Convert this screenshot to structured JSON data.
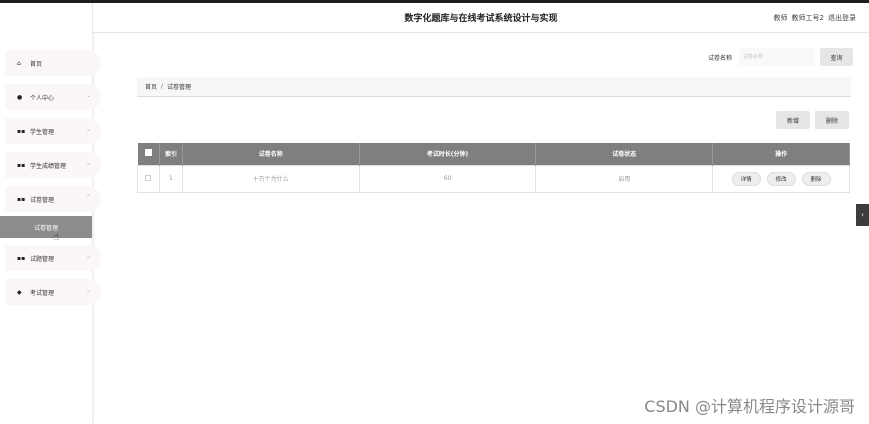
{
  "header": {
    "title": "数字化题库与在线考试系统设计与实现",
    "role": "教师",
    "username": "教师工号2",
    "logout": "退出登录"
  },
  "sidebar": {
    "items": [
      {
        "label": "首页",
        "icon": "home-icon",
        "glyph": "⌂",
        "has_chevron": false
      },
      {
        "label": "个人中心",
        "icon": "user-icon",
        "glyph": "●",
        "has_chevron": true
      },
      {
        "label": "学生管理",
        "icon": "grid-icon",
        "glyph": "▪▪",
        "has_chevron": true
      },
      {
        "label": "学生成绩管理",
        "icon": "grid-icon",
        "glyph": "▪▪",
        "has_chevron": true
      },
      {
        "label": "试卷管理",
        "icon": "grid-icon",
        "glyph": "▪▪",
        "has_chevron": true,
        "expanded": true
      },
      {
        "label": "试题管理",
        "icon": "grid-icon",
        "glyph": "▪▪",
        "has_chevron": true
      },
      {
        "label": "考试管理",
        "icon": "location-pin-icon",
        "glyph": "◆",
        "has_chevron": true
      }
    ],
    "active_sub_item": "试卷管理"
  },
  "search": {
    "label": "试卷名称",
    "placeholder": "试卷名称",
    "button": "查询"
  },
  "breadcrumb": {
    "home": "首页",
    "separator": "/",
    "current": "试卷管理"
  },
  "actions": {
    "add": "新增",
    "delete": "删除"
  },
  "table": {
    "columns": [
      "索引",
      "试卷名称",
      "考试时长(分钟)",
      "试卷状态",
      "操作"
    ],
    "rows": [
      {
        "index": "1",
        "name": "十万个为什么",
        "duration": "60",
        "status": "启用"
      }
    ],
    "row_actions": [
      "详情",
      "修改",
      "删除"
    ]
  },
  "watermark": "CSDN @计算机程序设计源哥",
  "colors": {
    "table_header": "#7f7f7f",
    "active_menu": "#8c8c8c",
    "menu_bg": "#fbf7f8"
  }
}
